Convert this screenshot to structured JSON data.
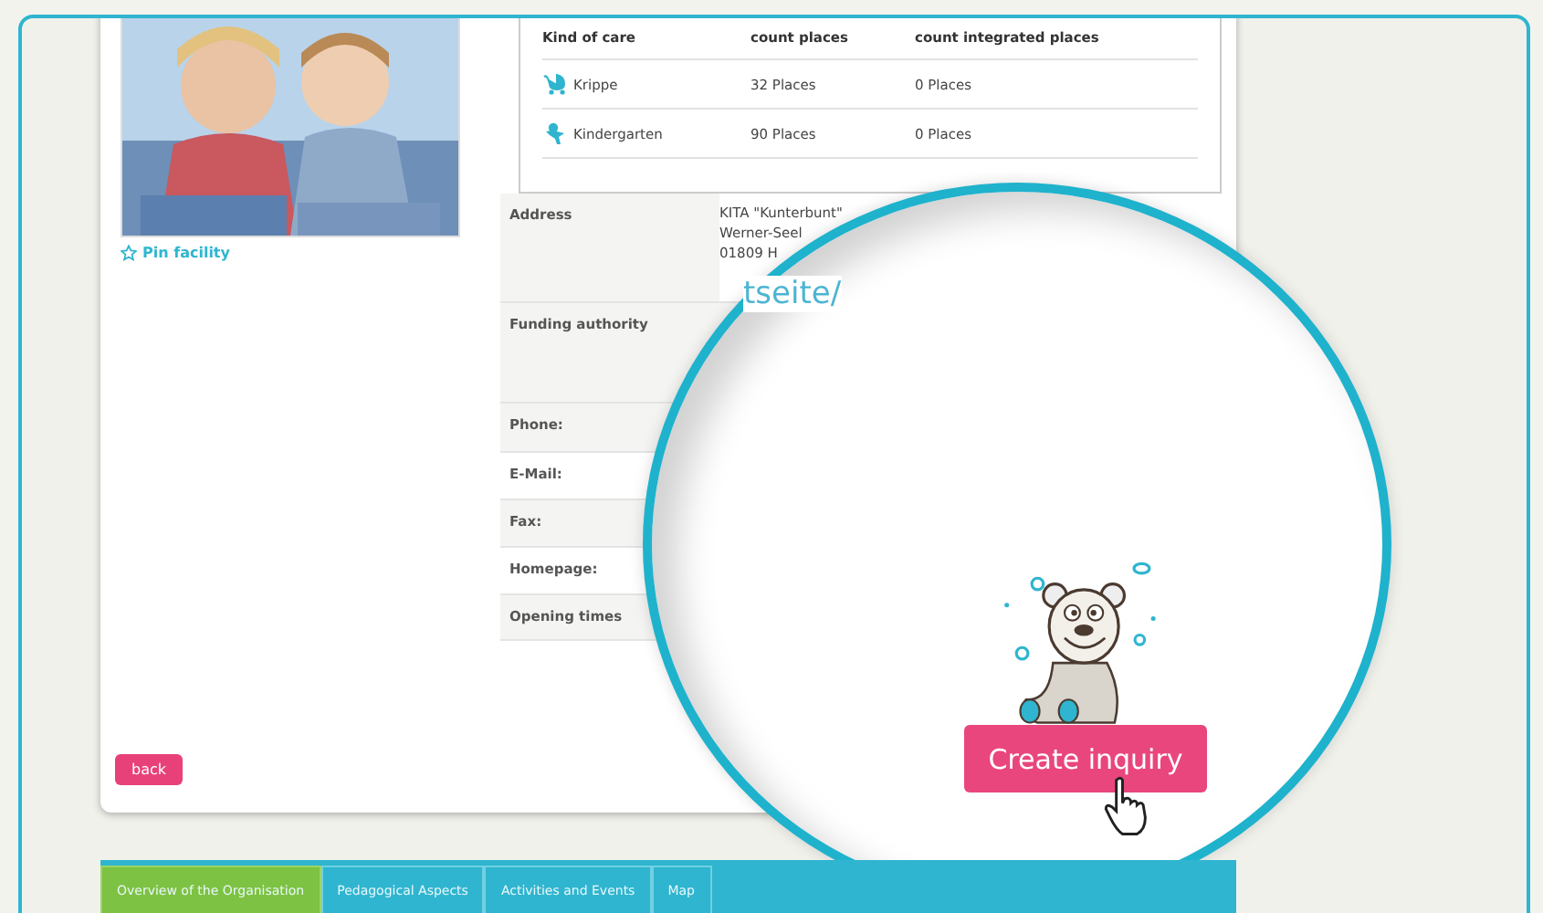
{
  "pin_link": {
    "label": "Pin facility"
  },
  "care_table": {
    "columns": [
      "Kind of care",
      "count places",
      "count integrated places"
    ],
    "rows": [
      {
        "kind": "pram",
        "name": "Krippe",
        "places": "32 Places",
        "integrated": "0 Places"
      },
      {
        "kind": "child",
        "name": "Kindergarten",
        "places": "90 Places",
        "integrated": "0 Places"
      }
    ]
  },
  "details": [
    {
      "label": "Address",
      "lines": [
        "KITA \"Kunterbunt\"",
        "Werner-Seel",
        "01809 H"
      ]
    },
    {
      "label": "Funding authority"
    },
    {
      "label": "Phone:"
    },
    {
      "label": "E-Mail:"
    },
    {
      "label": "Fax:"
    },
    {
      "label": "Homepage:"
    },
    {
      "label": "Opening times"
    }
  ],
  "back_button": {
    "label": "back"
  },
  "tabs": [
    {
      "label": "Overview of the Organisation",
      "selected": true
    },
    {
      "label": "Pedagogical Aspects",
      "selected": false
    },
    {
      "label": "Activities and Events",
      "selected": false
    },
    {
      "label": "Map",
      "selected": false
    }
  ],
  "magnifier": {
    "link_fragment": "tseite/",
    "button": "Create inquiry"
  }
}
